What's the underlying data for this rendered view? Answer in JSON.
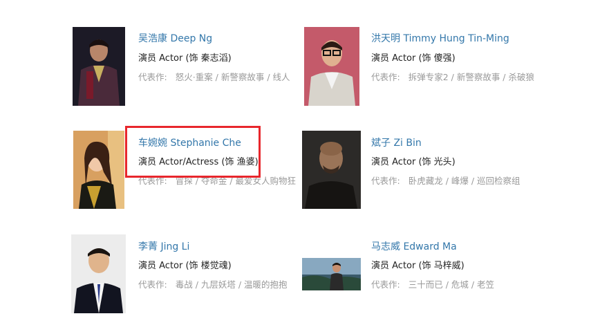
{
  "cast": [
    {
      "name": "吴浩康 Deep Ng",
      "role": "演员 Actor (饰 秦志滔)",
      "works_label": "代表作:",
      "works": "怒火·重案 / 新警察故事 / 线人",
      "photo_icon": "person-photo"
    },
    {
      "name": "洪天明 Timmy Hung Tin-Ming",
      "role": "演员 Actor (饰 傻强)",
      "works_label": "代表作:",
      "works": "拆弹专家2 / 新警察故事 / 杀破狼",
      "photo_icon": "person-photo"
    },
    {
      "name": "车婉婉 Stephanie Che",
      "role": "演员 Actor/Actress (饰 渔婆)",
      "works_label": "代表作:",
      "works": "冒探 / 夺命金 / 最爱女人购物狂",
      "photo_icon": "person-photo"
    },
    {
      "name": "斌子 Zi Bin",
      "role": "演员 Actor (饰 光头)",
      "works_label": "代表作:",
      "works": "卧虎藏龙 / 峰爆 / 巡回检察组",
      "photo_icon": "person-photo"
    },
    {
      "name": "李菁 Jing Li",
      "role": "演员 Actor (饰 楼觉魂)",
      "works_label": "代表作:",
      "works": "毒战 / 九层妖塔 / 温暖的抱抱",
      "photo_icon": "person-photo"
    },
    {
      "name": "马志威 Edward Ma",
      "role": "演员 Actor (饰 马梓威)",
      "works_label": "代表作:",
      "works": "三十而已 / 危城 / 老笠",
      "photo_icon": "person-photo"
    }
  ],
  "colors": {
    "link": "#3377aa",
    "highlight": "#e8262c",
    "muted": "#999999"
  }
}
